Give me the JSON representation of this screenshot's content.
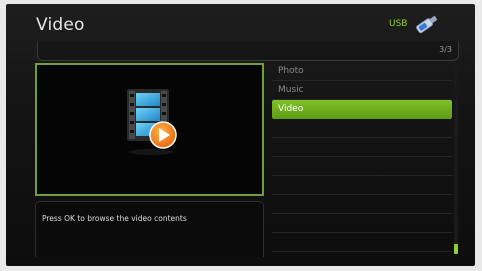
{
  "header": {
    "title": "Video",
    "device_label": "USB",
    "device_icon": "usb-stick-icon",
    "accent": "#8fd12e"
  },
  "breadcrumb": {
    "page_counter": "3/3"
  },
  "preview": {
    "icon": "video-film-play-icon",
    "description": "Press OK to browse the video contents"
  },
  "menu": {
    "items": [
      {
        "label": "Photo",
        "selected": false
      },
      {
        "label": "Music",
        "selected": false
      },
      {
        "label": "Video",
        "selected": true
      }
    ],
    "selected_color": "#6fb020"
  },
  "scroll": {
    "position": 1.0
  }
}
